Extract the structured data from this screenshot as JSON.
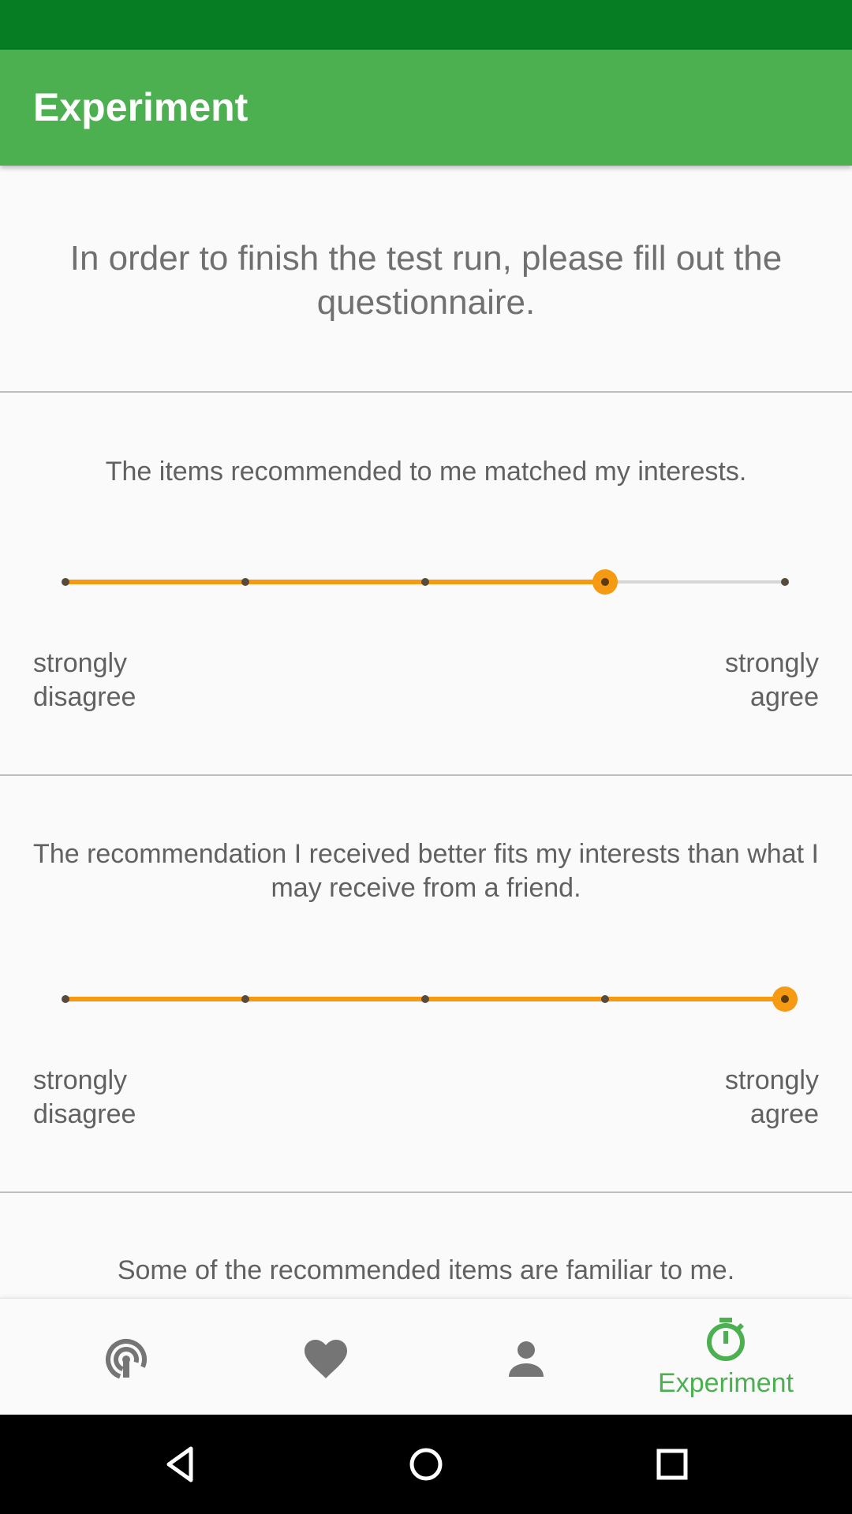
{
  "app_bar": {
    "title": "Experiment"
  },
  "intro_text": "In order to finish the test run, please fill out the questionnaire.",
  "questions": [
    {
      "text": "The items recommended to me matched my interests.",
      "value": 4,
      "min": 1,
      "max": 5,
      "label_min": "strongly\ndisagree",
      "label_max": "strongly\nagree"
    },
    {
      "text": "The recommendation I received better fits my interests than what I may receive from a friend.",
      "value": 5,
      "min": 1,
      "max": 5,
      "label_min": "strongly\ndisagree",
      "label_max": "strongly\nagree"
    },
    {
      "text": "Some of the recommended items are familiar to me."
    }
  ],
  "bottom_nav": {
    "items": [
      {
        "icon": "recommendations-signal-icon",
        "label": ""
      },
      {
        "icon": "heart-icon",
        "label": ""
      },
      {
        "icon": "person-icon",
        "label": ""
      },
      {
        "icon": "stopwatch-icon",
        "label": "Experiment",
        "active": true
      }
    ]
  },
  "colors": {
    "status_bar": "#067d22",
    "app_bar": "#4caf50",
    "slider_accent": "#f59a12",
    "nav_active": "#4caf50",
    "nav_inactive": "#757575"
  }
}
